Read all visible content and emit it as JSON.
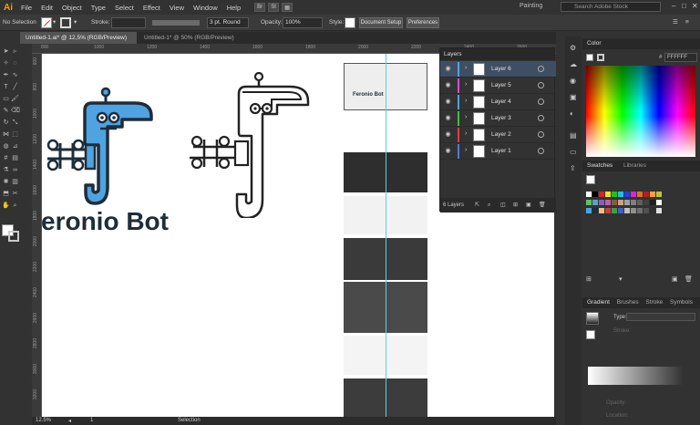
{
  "app": {
    "logo": "Ai",
    "workspace": "Painting",
    "search_placeholder": "Search Adobe Stock"
  },
  "menu": [
    "File",
    "Edit",
    "Object",
    "Type",
    "Select",
    "Effect",
    "View",
    "Window",
    "Help"
  ],
  "menu_buttons": [
    "Br",
    "St"
  ],
  "control_bar": {
    "selection": "No Selection",
    "stroke_label": "Stroke:",
    "brush": "3 pt. Round",
    "opacity_label": "Opacity:",
    "opacity_value": "100%",
    "style_label": "Style:",
    "document_setup": "Document Setup",
    "preferences": "Preferences"
  },
  "tabs": [
    {
      "label": "Untitled-1.ai* @ 12,5% (RGB/Preview)",
      "active": true
    },
    {
      "label": "Untitled-1* @ 50% (RGB/Preview)",
      "active": false
    }
  ],
  "ruler_h": [
    "800",
    "1000",
    "1200",
    "1400",
    "1600",
    "1800",
    "2000",
    "2200",
    "2400",
    "2600"
  ],
  "ruler_v": [
    "600",
    "800",
    "1000",
    "1200",
    "1400",
    "1600",
    "1800",
    "2000",
    "2200",
    "2400",
    "2600",
    "2800",
    "3000",
    "3200"
  ],
  "artwork": {
    "title": "eronio Bot",
    "thumb_title": "Feronio Bot"
  },
  "layers_panel": {
    "title": "Layers",
    "layers": [
      {
        "name": "Layer 6",
        "color": "#4fa3e0",
        "selected": true
      },
      {
        "name": "Layer 5",
        "color": "#d14fd1",
        "selected": false
      },
      {
        "name": "Layer 4",
        "color": "#4fa3e0",
        "selected": false
      },
      {
        "name": "Layer 3",
        "color": "#40c040",
        "selected": false
      },
      {
        "name": "Layer 2",
        "color": "#d84040",
        "selected": false
      },
      {
        "name": "Layer 1",
        "color": "#4f7ae0",
        "selected": false
      }
    ],
    "footer": "6 Layers"
  },
  "color_panel": {
    "title": "Color",
    "hex": "FFFFFF"
  },
  "swatches_panel": {
    "tab1": "Swatches",
    "tab2": "Libraries"
  },
  "gradient_panel": {
    "tabs": [
      "Gradient",
      "Brushes",
      "Stroke",
      "Symbols"
    ],
    "type_label": "Type:",
    "stroke_label": "Stroke:",
    "opacity_label": "Opacity:",
    "location_label": "Location:"
  },
  "status": {
    "zoom": "12.5%",
    "artboard": "1",
    "tool": "Selection"
  }
}
